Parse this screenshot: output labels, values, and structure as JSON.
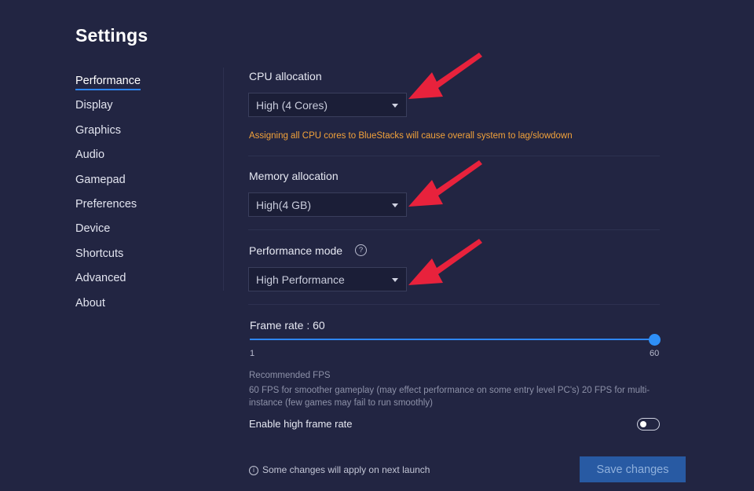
{
  "page": {
    "title": "Settings"
  },
  "sidebar": {
    "items": [
      {
        "label": "Performance",
        "active": true
      },
      {
        "label": "Display"
      },
      {
        "label": "Graphics"
      },
      {
        "label": "Audio"
      },
      {
        "label": "Gamepad"
      },
      {
        "label": "Preferences"
      },
      {
        "label": "Device"
      },
      {
        "label": "Shortcuts"
      },
      {
        "label": "Advanced"
      },
      {
        "label": "About"
      }
    ]
  },
  "cpu": {
    "label": "CPU allocation",
    "value": "High (4 Cores)",
    "warning": "Assigning all CPU cores to BlueStacks will cause overall system to lag/slowdown"
  },
  "memory": {
    "label": "Memory allocation",
    "value": "High(4 GB)"
  },
  "perf_mode": {
    "label": "Performance mode",
    "help_icon": "?",
    "value": "High Performance"
  },
  "frame_rate": {
    "label": "Frame rate : 60",
    "value": 60,
    "min_label": "1",
    "max_label": "60",
    "recommended_title": "Recommended FPS",
    "recommended_text": "60 FPS for smoother gameplay (may effect performance on some entry level PC's) 20 FPS for multi-instance (few games may fail to run smoothly)"
  },
  "high_frame_rate": {
    "label": "Enable high frame rate",
    "enabled": false
  },
  "footer": {
    "info_icon": "i",
    "note": "Some changes will apply on next launch",
    "save_label": "Save changes"
  },
  "colors": {
    "background": "#222542",
    "accent": "#2e86f5",
    "warning": "#f2a23a",
    "annotation_arrow": "#e8223c"
  }
}
